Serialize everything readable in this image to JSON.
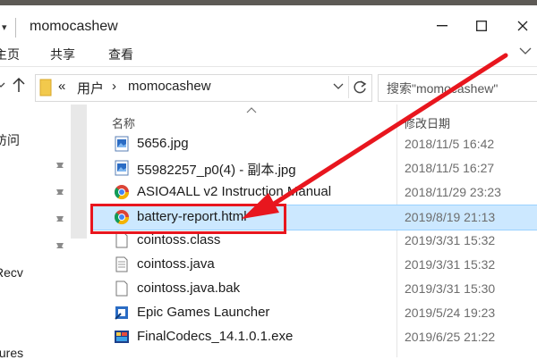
{
  "window": {
    "title": "momocashew",
    "dropdown_glyph": "▾"
  },
  "ribbon": {
    "tabs": [
      "主页",
      "共享",
      "查看"
    ]
  },
  "address": {
    "path_prefix": "«",
    "crumbs": [
      "用户",
      "momocashew"
    ],
    "separator": "›",
    "search_placeholder": "搜索\"momocashew\""
  },
  "sidebar": {
    "items": [
      "访问",
      "Recv",
      "ctures"
    ]
  },
  "columns": {
    "name": "名称",
    "date": "修改日期"
  },
  "files": [
    {
      "name": "5656.jpg",
      "date": "2018/11/5 16:42",
      "icon": "image-file-icon"
    },
    {
      "name": "55982257_p0(4) - 副本.jpg",
      "date": "2018/11/5 16:27",
      "icon": "image-file-icon"
    },
    {
      "name": "ASIO4ALL v2 Instruction Manual",
      "date": "2018/11/29 23:23",
      "icon": "chrome-icon"
    },
    {
      "name": "battery-report.html",
      "date": "2019/8/19 21:13",
      "icon": "chrome-icon",
      "selected": true
    },
    {
      "name": "cointoss.class",
      "date": "2019/3/31 15:32",
      "icon": "blank-file-icon"
    },
    {
      "name": "cointoss.java",
      "date": "2019/3/31 15:32",
      "icon": "text-file-icon"
    },
    {
      "name": "cointoss.java.bak",
      "date": "2019/3/31 15:30",
      "icon": "blank-file-icon"
    },
    {
      "name": "Epic Games Launcher",
      "date": "2019/5/24 19:23",
      "icon": "shortcut-icon"
    },
    {
      "name": "FinalCodecs_14.1.0.1.exe",
      "date": "2019/6/25 21:22",
      "icon": "installer-icon"
    }
  ],
  "colors": {
    "selection": "#cce8ff",
    "highlight": "#e8161e"
  }
}
